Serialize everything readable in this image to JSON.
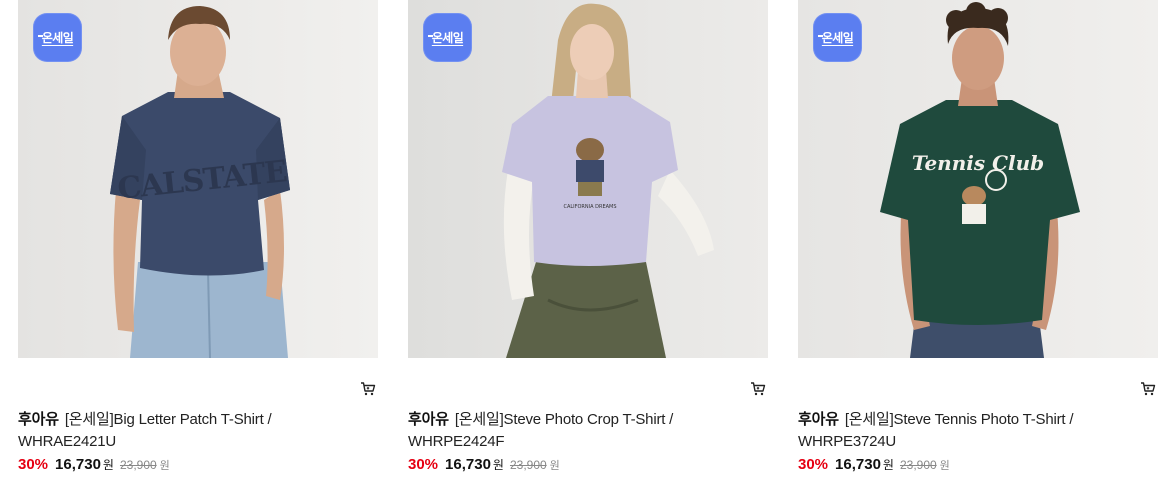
{
  "badge_label": "온세일",
  "colors": {
    "badge": "#5b7ef0",
    "discount": "#e60012",
    "original_price": "#888888"
  },
  "products": [
    {
      "brand": "후아유",
      "name": "[온세일]Big Letter Patch T-Shirt /",
      "code": "WHRAE2421U",
      "discount": "30%",
      "price": "16,730",
      "price_unit": "원",
      "original_price": "23,900",
      "original_unit": "원",
      "shirt_print": "CALSTATE"
    },
    {
      "brand": "후아유",
      "name": "[온세일]Steve Photo Crop T-Shirt /",
      "code": "WHRPE2424F",
      "discount": "30%",
      "price": "16,730",
      "price_unit": "원",
      "original_price": "23,900",
      "original_unit": "원",
      "shirt_print": "CALIFORNIA DREAMS"
    },
    {
      "brand": "후아유",
      "name": "[온세일]Steve Tennis Photo T-Shirt /",
      "code": "WHRPE3724U",
      "discount": "30%",
      "price": "16,730",
      "price_unit": "원",
      "original_price": "23,900",
      "original_unit": "원",
      "shirt_print": "Tennis Club"
    }
  ]
}
